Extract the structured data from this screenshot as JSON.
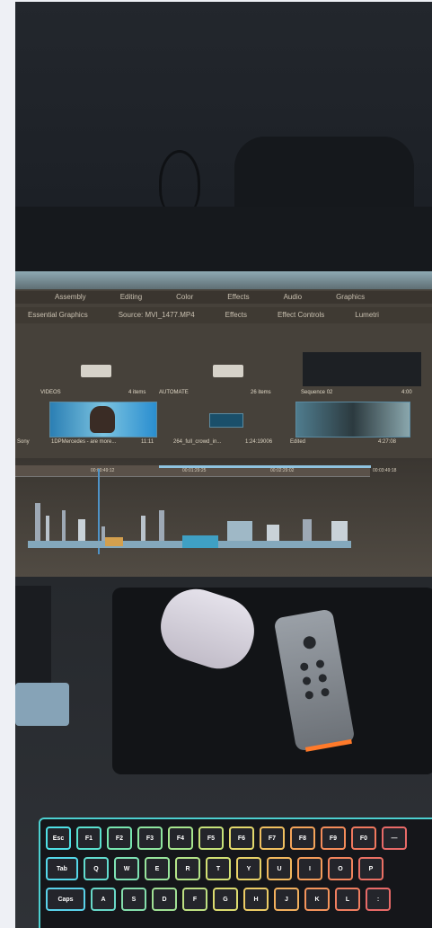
{
  "image": {
    "alt": "Desk setup with a video editing timeline on a monitor, white earbud case, remote and RGB keyboard",
    "accent_colors": [
      "#4cd0d0",
      "#ff7a2a",
      "#4f93c7"
    ]
  },
  "screen": {
    "menu_top": [
      "Assembly",
      "Editing",
      "Color",
      "Effects",
      "Audio",
      "Graphics"
    ],
    "menu_panel": [
      "Essential Graphics",
      "Source: MVI_1477.MP4",
      "Effects",
      "Effect Controls",
      "Lumetri"
    ],
    "bins": [
      {
        "label": "VIDEOS",
        "count": "4 items"
      },
      {
        "label": "AUTOMATE",
        "count": "26 items"
      },
      {
        "label": "Sequence 02",
        "count": "4:00"
      }
    ],
    "clips": [
      "Sony",
      "1DPMercedes - are more...",
      "11:11",
      "264_full_crowd_in...",
      "1:24:19006",
      "Edited",
      "4:27:08"
    ],
    "timecodes": [
      "00:00:49:12",
      "00:01:29:25",
      "00:02:29:02",
      "00:03:49:18"
    ]
  },
  "keyboard": {
    "row1": [
      "Esc",
      "F1",
      "F2",
      "F3",
      "F4",
      "F5",
      "F6",
      "F7",
      "F8",
      "F9",
      "F0",
      "—"
    ],
    "row2": [
      "Tab",
      "Q",
      "W",
      "E",
      "R",
      "T",
      "Y",
      "U",
      "I",
      "O",
      "P"
    ],
    "row3": [
      "Caps",
      "A",
      "S",
      "D",
      "F",
      "G",
      "H",
      "J",
      "K",
      "L",
      ":"
    ]
  }
}
